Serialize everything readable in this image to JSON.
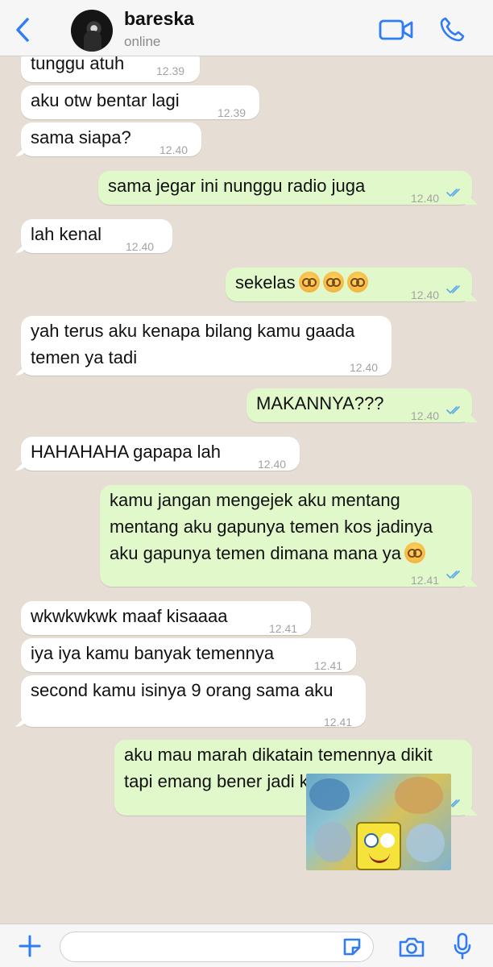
{
  "header": {
    "contact_name": "bareska",
    "status": "online"
  },
  "messages": [
    {
      "dir": "in",
      "text": "tunggu atuh",
      "time": "12.39"
    },
    {
      "dir": "in",
      "text": "aku otw bentar lagi",
      "time": "12.39"
    },
    {
      "dir": "in",
      "text": "sama siapa?",
      "time": "12.40"
    },
    {
      "dir": "out",
      "text": "sama jegar ini nunggu radio juga",
      "time": "12.40",
      "read": true
    },
    {
      "dir": "in",
      "text": "lah kenal",
      "time": "12.40"
    },
    {
      "dir": "out",
      "text": "sekelas",
      "emoji_count": 3,
      "time": "12.40",
      "read": true
    },
    {
      "dir": "in",
      "text": "yah terus aku kenapa bilang kamu gaada\ntemen ya tadi",
      "time": "12.40"
    },
    {
      "dir": "out",
      "text": "MAKANNYA???",
      "time": "12.40",
      "read": true
    },
    {
      "dir": "in",
      "text": "HAHAHAHA gapapa lah",
      "time": "12.40"
    },
    {
      "dir": "out",
      "text": "kamu jangan mengejek aku mentang\nmentang aku gapunya temen kos jadinya\naku gapunya temen dimana mana ya",
      "emoji_count": 1,
      "time": "12.41",
      "read": true
    },
    {
      "dir": "in",
      "text": "wkwkwkwk maaf kisaaaa",
      "time": "12.41"
    },
    {
      "dir": "in",
      "text": "iya iya kamu banyak temennya",
      "time": "12.41"
    },
    {
      "dir": "in",
      "text": "second kamu isinya 9 orang sama aku",
      "time": "12.41"
    },
    {
      "dir": "out",
      "text": "aku mau marah dikatain temennya dikit\ntapi emang bener jadi kamu aku maafin",
      "time": "12.41",
      "read": true
    }
  ],
  "sticker": {
    "icon": "spongebob-sticker"
  },
  "colors": {
    "accent": "#2f7cf6",
    "incoming_bubble": "#ffffff",
    "outgoing_bubble": "#e1f8cb",
    "chat_background": "#e6ddd4",
    "read_ticks": "#5aa9e6"
  },
  "composer": {
    "value": "",
    "placeholder": ""
  }
}
